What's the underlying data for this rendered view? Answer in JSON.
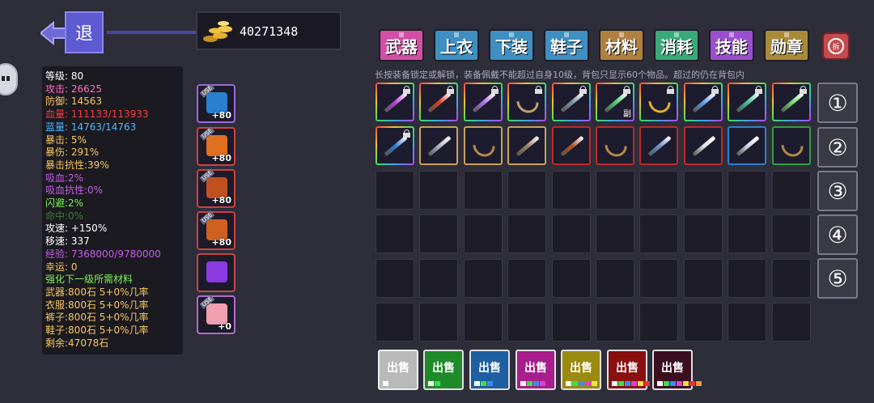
{
  "header": {
    "back_label": "退",
    "gold_amount": "40271348"
  },
  "stats": [
    {
      "text": "等级: 80",
      "color": "#ffffff"
    },
    {
      "text": "攻击: 26625",
      "color": "#ff6ec7"
    },
    {
      "text": "防御: 14563",
      "color": "#f6c760"
    },
    {
      "text": "血量: 111133/113933",
      "color": "#ff3b3b"
    },
    {
      "text": "蓝量: 14763/14763",
      "color": "#4db8ff"
    },
    {
      "text": "暴击: 5%",
      "color": "#f6c760"
    },
    {
      "text": "暴伤: 291%",
      "color": "#f6c760"
    },
    {
      "text": "暴击抗性:39%",
      "color": "#f6c760"
    },
    {
      "text": "吸血:2%",
      "color": "#c55ee8"
    },
    {
      "text": "吸血抗性:0%",
      "color": "#c55ee8"
    },
    {
      "text": "闪避:2%",
      "color": "#7df05a"
    },
    {
      "text": "命中:0%",
      "color": "#3e7a30"
    },
    {
      "text": "攻速: +150%",
      "color": "#ffffff"
    },
    {
      "text": "移速: 337",
      "color": "#ffffff"
    },
    {
      "text": "经验: 7368000/9780000",
      "color": "#c55ee8"
    },
    {
      "text": "幸运: 0",
      "color": "#f6c760"
    },
    {
      "text": "强化下一级所需材料",
      "color": "#7df05a"
    },
    {
      "text": "武器:800石 5+0%几率",
      "color": "#f6c760"
    },
    {
      "text": "衣服:800石 5+0%几率",
      "color": "#f6c760"
    },
    {
      "text": "裤子:800石 5+0%几率",
      "color": "#f6c760"
    },
    {
      "text": "鞋子:800石 5+0%几率",
      "color": "#f6c760"
    },
    {
      "text": "剩余:47078石",
      "color": "#f6c760"
    }
  ],
  "equipped": [
    {
      "name": "equipped-weapon",
      "level": "+80",
      "icon": "gun-icon",
      "border": "#9a6ade",
      "art": "#2a7fd0"
    },
    {
      "name": "equipped-top",
      "level": "+80",
      "icon": "armor-icon",
      "border": "#d04040",
      "art": "#e07020"
    },
    {
      "name": "equipped-bottom",
      "level": "+80",
      "icon": "pants-icon",
      "border": "#d04040",
      "art": "#c05020"
    },
    {
      "name": "equipped-shoes",
      "level": "+80",
      "icon": "boots-icon",
      "border": "#d04040",
      "art": "#d06020"
    },
    {
      "name": "equipped-material",
      "level": "",
      "icon": "purple-orb-icon",
      "border": "#c04848",
      "art": "#8a3ae0"
    },
    {
      "name": "equipped-medal",
      "level": "+0",
      "icon": "medal-icon",
      "border": "#b06ad0",
      "art": "#f0a0b0"
    }
  ],
  "tabs": [
    {
      "label": "武器",
      "color": "#d24fa6"
    },
    {
      "label": "上衣",
      "color": "#3f8fc2"
    },
    {
      "label": "下装",
      "color": "#3f8fc2"
    },
    {
      "label": "鞋子",
      "color": "#3f8fc2"
    },
    {
      "label": "材料",
      "color": "#b08040"
    },
    {
      "label": "消耗",
      "color": "#3aa97a"
    },
    {
      "label": "技能",
      "color": "#9b4fd0"
    },
    {
      "label": "勋章",
      "color": "#a88a3a"
    }
  ],
  "refresh_label": "拆",
  "hint_text": "长按装备锁定或解锁，装备佩戴不能超过自身10级，背包只显示60个物品。超过的仍在背包内",
  "bag": {
    "row1": [
      {
        "border": "rainbow",
        "kind": "weapon",
        "art": "#c040e0",
        "locked": true,
        "sub": ""
      },
      {
        "border": "rainbow",
        "kind": "weapon",
        "art": "#e04020",
        "locked": true,
        "sub": ""
      },
      {
        "border": "rainbow",
        "kind": "weapon",
        "art": "#b070f0",
        "locked": true,
        "sub": ""
      },
      {
        "border": "rainbow",
        "kind": "bow",
        "art": "#c0a070",
        "locked": true,
        "sub": ""
      },
      {
        "border": "rainbow",
        "kind": "weapon",
        "art": "#8090a0",
        "locked": true,
        "sub": ""
      },
      {
        "border": "rainbow",
        "kind": "weapon",
        "art": "#50d070",
        "locked": true,
        "sub": "副"
      },
      {
        "border": "rainbow",
        "kind": "bow",
        "art": "#e0b030",
        "locked": true,
        "sub": ""
      },
      {
        "border": "rainbow",
        "kind": "weapon",
        "art": "#60a0f0",
        "locked": true,
        "sub": ""
      },
      {
        "border": "rainbow",
        "kind": "weapon",
        "art": "#40c0a0",
        "locked": true,
        "sub": ""
      },
      {
        "border": "rainbow",
        "kind": "weapon",
        "art": "#70e070",
        "locked": true,
        "sub": ""
      }
    ],
    "row2": [
      {
        "border": "rainbow",
        "kind": "weapon",
        "art": "#2a7fd0",
        "locked": true,
        "sub": ""
      },
      {
        "border": "#c8a060",
        "kind": "weapon",
        "art": "#b0b8c8",
        "locked": false,
        "sub": ""
      },
      {
        "border": "#c8a060",
        "kind": "bow",
        "art": "#b38a4a",
        "locked": false,
        "sub": ""
      },
      {
        "border": "#c8a060",
        "kind": "weapon",
        "art": "#a08060",
        "locked": false,
        "sub": ""
      },
      {
        "border": "#c02828",
        "kind": "weapon",
        "art": "#b05020",
        "locked": false,
        "sub": ""
      },
      {
        "border": "#c02828",
        "kind": "bow",
        "art": "#b38a4a",
        "locked": false,
        "sub": ""
      },
      {
        "border": "#c02828",
        "kind": "weapon",
        "art": "#7090d0",
        "locked": false,
        "sub": ""
      },
      {
        "border": "#c02828",
        "kind": "weapon",
        "art": "#e0e0e0",
        "locked": false,
        "sub": ""
      },
      {
        "border": "#2f7fd0",
        "kind": "weapon",
        "art": "#d0d8e8",
        "locked": false,
        "sub": ""
      },
      {
        "border": "#30a040",
        "kind": "bow",
        "art": "#b38a4a",
        "locked": false,
        "sub": ""
      }
    ],
    "empty_rows": 4
  },
  "page_buttons": [
    "①",
    "②",
    "③",
    "④",
    "⑤"
  ],
  "sell_buttons": [
    {
      "label": "出售",
      "bg": "#b9b9b9",
      "border": "#f0f0f0",
      "dots": [
        "#ffffff"
      ]
    },
    {
      "label": "出售",
      "bg": "#1f8a2a",
      "border": "#e0e0e0",
      "dots": [
        "#ffffff",
        "#3be04a"
      ]
    },
    {
      "label": "出售",
      "bg": "#1d5fa0",
      "border": "#e0e0e0",
      "dots": [
        "#ffffff",
        "#3be04a",
        "#3b8ef0"
      ]
    },
    {
      "label": "出售",
      "bg": "#a81e8c",
      "border": "#e0e0e0",
      "dots": [
        "#ffffff",
        "#3be04a",
        "#3b8ef0",
        "#e040d0"
      ]
    },
    {
      "label": "出售",
      "bg": "#9a8a10",
      "border": "#e0e0e0",
      "dots": [
        "#ffffff",
        "#3be04a",
        "#3b8ef0",
        "#e040d0",
        "#f0e040"
      ]
    },
    {
      "label": "出售",
      "bg": "#8a1010",
      "border": "#e0e0e0",
      "dots": [
        "#ffffff",
        "#3be04a",
        "#3b8ef0",
        "#e040d0",
        "#f0e040",
        "#f03030"
      ]
    },
    {
      "label": "出售",
      "bg": "#3a1020",
      "border": "#e0e0e0",
      "dots": [
        "#ffffff",
        "#3be04a",
        "#3b8ef0",
        "#e040d0",
        "#f0e040",
        "#f03030",
        "#f0a030"
      ]
    }
  ]
}
